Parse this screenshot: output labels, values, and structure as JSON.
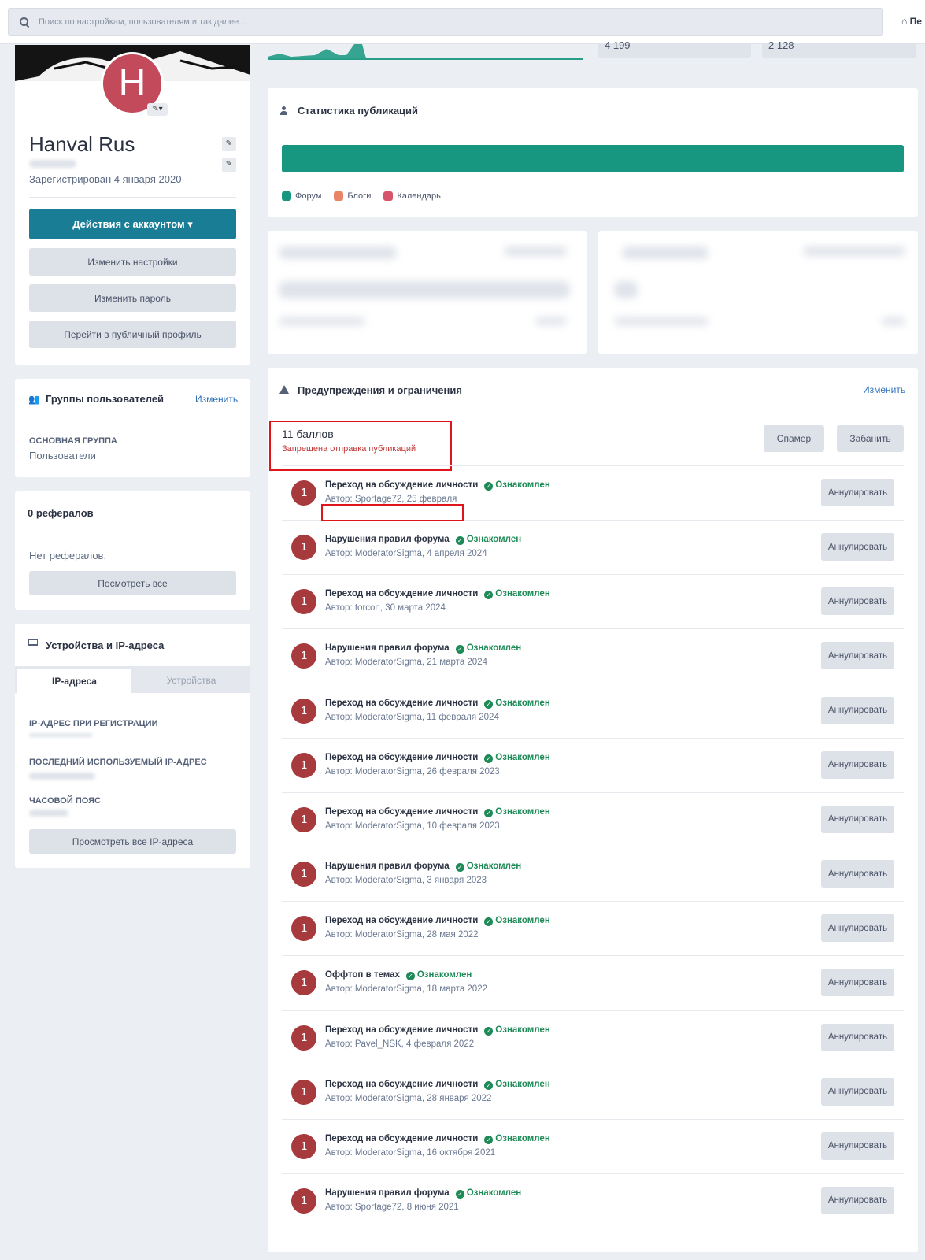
{
  "search": {
    "placeholder": "Поиск по настройкам, пользователям и так далее..."
  },
  "header": {
    "home_label": "Пе"
  },
  "profile": {
    "name": "Hanval Rus",
    "registered": "Зарегистрирован 4 января 2020",
    "avatar_letter": "H",
    "actions_button": "Действия с аккаунтом ▾",
    "change_settings": "Изменить настройки",
    "change_password": "Изменить пароль",
    "public_profile": "Перейти в публичный профиль"
  },
  "groups": {
    "title": "Группы пользователей",
    "edit": "Изменить",
    "main_group_label": "Основная группа",
    "main_group_value": "Пользователи"
  },
  "referrals": {
    "title": "0 рефералов",
    "empty": "Нет рефералов.",
    "view_all": "Посмотреть все"
  },
  "devices": {
    "title": "Устройства и IP-адреса",
    "tab_ip": "IP-адреса",
    "tab_devices": "Устройства",
    "reg_ip_label": "IP-адрес при регистрации",
    "last_ip_label": "Последний используемый IP-адрес",
    "timezone_label": "Часовой пояс",
    "view_all_ip": "Просмотреть все IP-адреса"
  },
  "stats_top": {
    "value1": "4 199",
    "value2": "2 128"
  },
  "pub_stats": {
    "title": "Статистика публикаций",
    "legend": [
      {
        "label": "Форум",
        "color": "#17977f"
      },
      {
        "label": "Блоги",
        "color": "#e98466"
      },
      {
        "label": "Календарь",
        "color": "#d7556a"
      }
    ]
  },
  "warnings": {
    "title": "Предупреждения и ограничения",
    "edit": "Изменить",
    "points": "11 баллов",
    "restriction": "Запрещена отправка публикаций",
    "spammer": "Спамер",
    "ban": "Забанить",
    "ack_label": "Ознакомлен",
    "revoke_label": "Аннулировать",
    "items": [
      {
        "points": "1",
        "title": "Переход на обсуждение личности",
        "meta": "Автор: Sportage72, 25 февраля"
      },
      {
        "points": "1",
        "title": "Нарушения правил форума",
        "meta": "Автор: ModeratorSigma, 4 апреля 2024"
      },
      {
        "points": "1",
        "title": "Переход на обсуждение личности",
        "meta": "Автор: torcon, 30 марта 2024"
      },
      {
        "points": "1",
        "title": "Нарушения правил форума",
        "meta": "Автор: ModeratorSigma, 21 марта 2024"
      },
      {
        "points": "1",
        "title": "Переход на обсуждение личности",
        "meta": "Автор: ModeratorSigma, 11 февраля 2024"
      },
      {
        "points": "1",
        "title": "Переход на обсуждение личности",
        "meta": "Автор: ModeratorSigma, 26 февраля 2023"
      },
      {
        "points": "1",
        "title": "Переход на обсуждение личности",
        "meta": "Автор: ModeratorSigma, 10 февраля 2023"
      },
      {
        "points": "1",
        "title": "Нарушения правил форума",
        "meta": "Автор: ModeratorSigma, 3 января 2023"
      },
      {
        "points": "1",
        "title": "Переход на обсуждение личности",
        "meta": "Автор: ModeratorSigma, 28 мая 2022"
      },
      {
        "points": "1",
        "title": "Оффтоп в темах",
        "meta": "Автор: ModeratorSigma, 18 марта 2022"
      },
      {
        "points": "1",
        "title": "Переход на обсуждение личности",
        "meta": "Автор: Pavel_NSK, 4 февраля 2022"
      },
      {
        "points": "1",
        "title": "Переход на обсуждение личности",
        "meta": "Автор: ModeratorSigma, 28 января 2022"
      },
      {
        "points": "1",
        "title": "Переход на обсуждение личности",
        "meta": "Автор: ModeratorSigma, 16 октября 2021"
      },
      {
        "points": "1",
        "title": "Нарушения правил форума",
        "meta": "Автор: Sportage72, 8 июня 2021"
      }
    ]
  }
}
